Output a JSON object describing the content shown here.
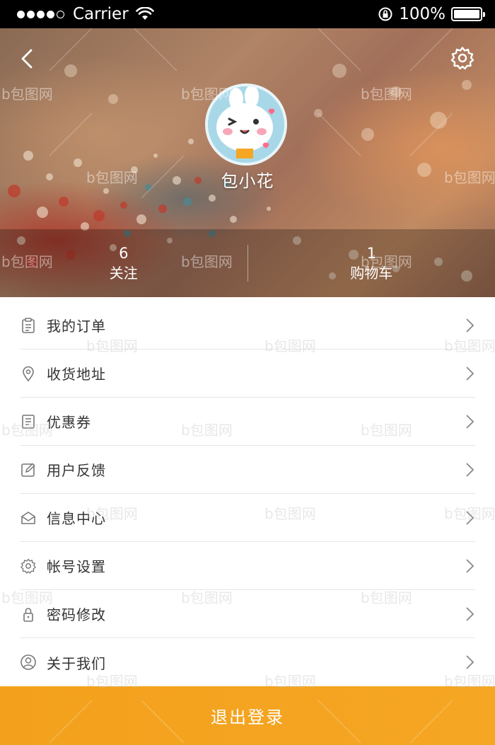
{
  "status_bar": {
    "carrier": "Carrier",
    "battery": "100%",
    "icons": [
      "signal-dots-icon",
      "wifi-icon",
      "orientation-lock-icon",
      "battery-icon"
    ]
  },
  "header": {
    "username": "包小花",
    "icons": [
      "back-icon",
      "settings-icon"
    ],
    "stats": [
      {
        "value": "6",
        "label": "关注"
      },
      {
        "value": "1",
        "label": "购物车"
      }
    ]
  },
  "menu": {
    "items": [
      {
        "label": "我的订单",
        "icon": "clipboard-icon"
      },
      {
        "label": "收货地址",
        "icon": "location-pin-icon"
      },
      {
        "label": "优惠券",
        "icon": "coupon-icon"
      },
      {
        "label": "用户反馈",
        "icon": "edit-icon"
      },
      {
        "label": "信息中心",
        "icon": "mail-icon"
      },
      {
        "label": "帐号设置",
        "icon": "gear-icon"
      },
      {
        "label": "密码修改",
        "icon": "lock-icon"
      },
      {
        "label": "关于我们",
        "icon": "user-circle-icon"
      }
    ]
  },
  "logout_label": "退出登录",
  "watermark": {
    "text": "包图网",
    "letter": "b"
  },
  "colors": {
    "accent": "#f5a623",
    "status_bar": "#000000",
    "menu_text": "#333333",
    "divider": "#e6e6e6"
  }
}
